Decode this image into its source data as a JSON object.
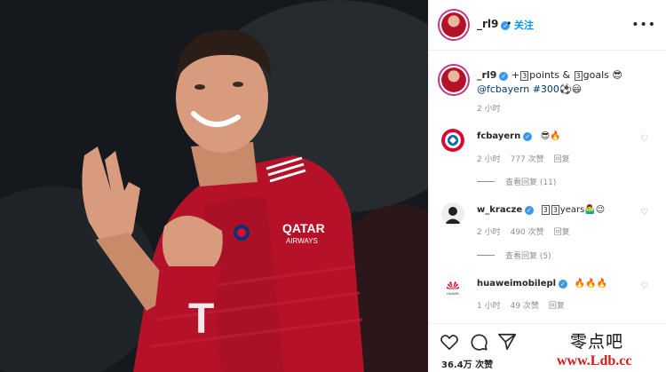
{
  "post": {
    "author": "_rl9",
    "follow_label": "关注",
    "separator": "•",
    "more_icon": "more-horizontal-icon",
    "caption_user": "_rl9",
    "caption_part1": "+",
    "caption_num1": "3",
    "caption_part2": "points & ",
    "caption_num2": "3",
    "caption_part3": "goals 😎",
    "caption_line2_tag": "@fcbayern #300",
    "caption_line2_emoji": "⚽😃",
    "caption_time": "2 小时"
  },
  "comments": [
    {
      "user": "fcbayern",
      "text": "😎🔥",
      "time": "2 小时",
      "likes": "777 次赞",
      "reply": "回复",
      "view_replies": "查看回复 (11)"
    },
    {
      "user": "w_kracze",
      "num1": "3",
      "num2": "3",
      "text_suffix": "years🤷‍♂️😉",
      "time": "2 小时",
      "likes": "490 次赞",
      "reply": "回复",
      "view_replies": "查看回复 (5)"
    },
    {
      "user": "huaweimobilepl",
      "text": "🔥🔥🔥",
      "time": "1 小时",
      "likes": "49 次赞",
      "reply": "回复"
    }
  ],
  "actions": {
    "like_icon": "heart-icon",
    "comment_icon": "comment-icon",
    "share_icon": "send-icon",
    "likes_count": "36.4万 次赞"
  },
  "watermark": {
    "text": "零点吧",
    "url": "www.Ldb.cc"
  },
  "colors": {
    "jersey": "#b5122a",
    "link": "#0095f6",
    "verified": "#3897f0",
    "watermark_url": "#d41a1a"
  }
}
